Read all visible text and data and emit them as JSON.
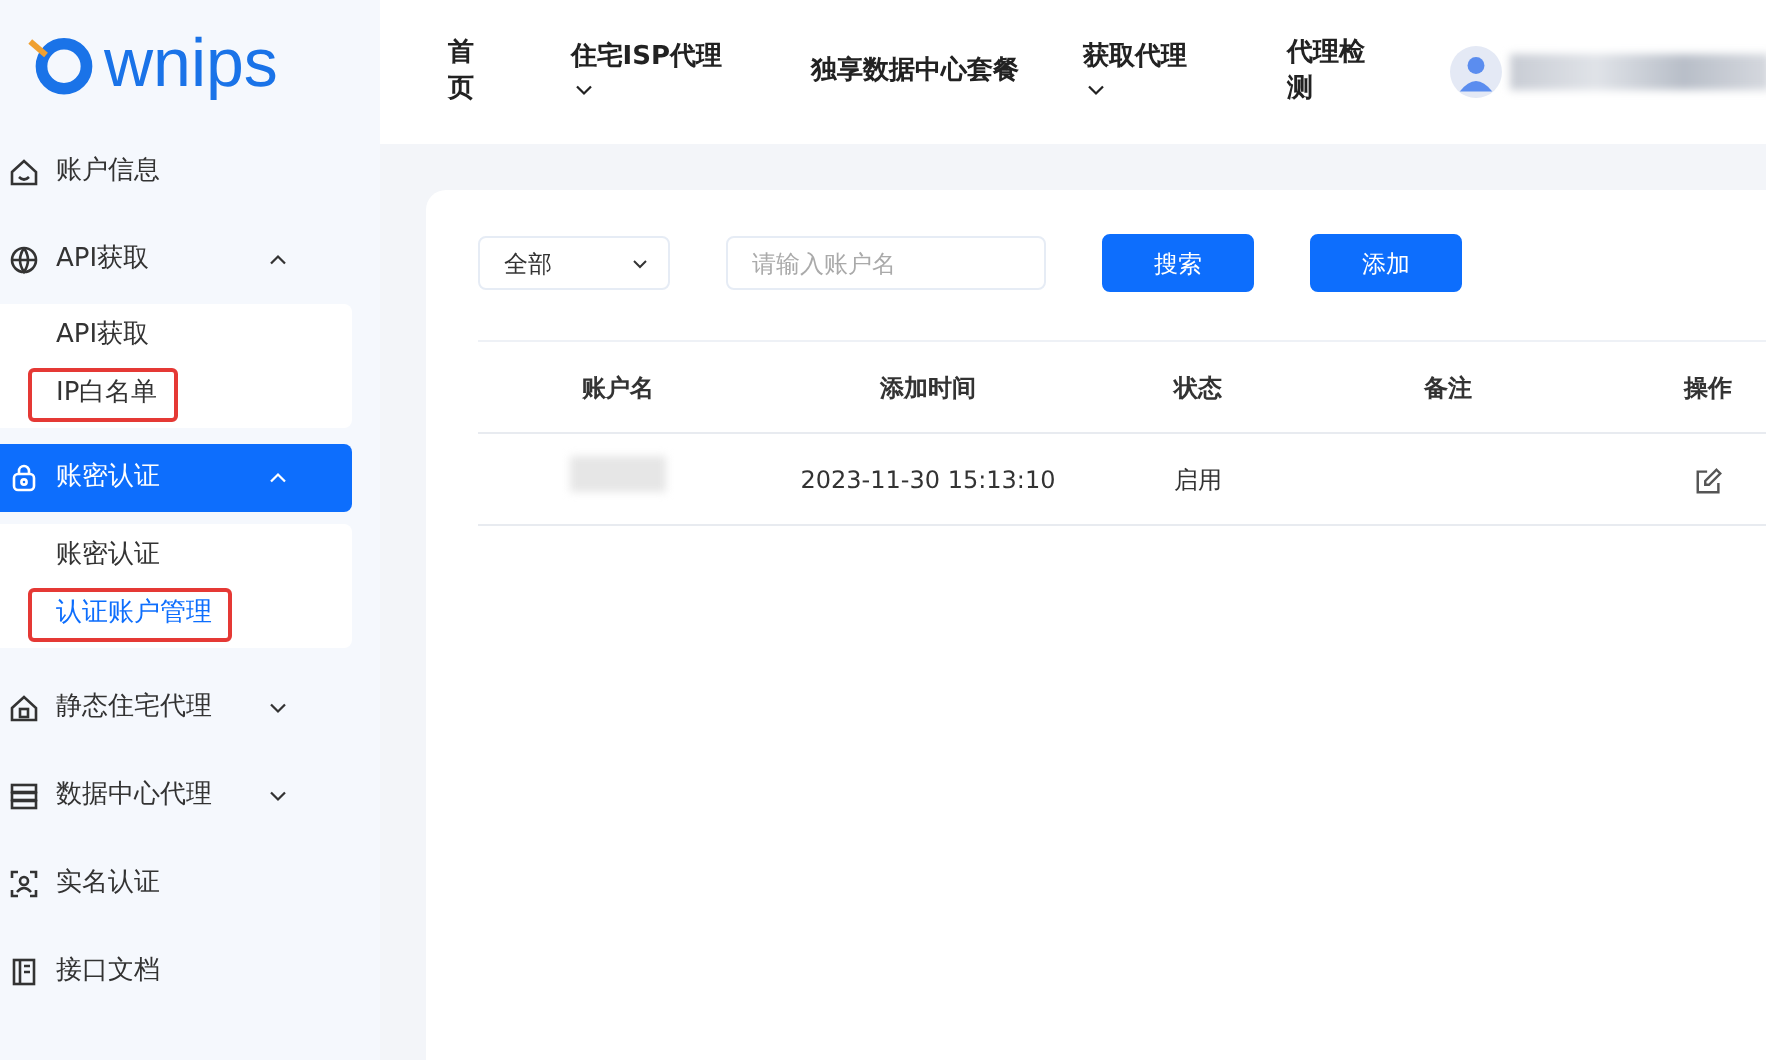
{
  "logo": {
    "text": "wnips"
  },
  "sidebar": [
    {
      "label": "账户信息",
      "kind": "item",
      "selected": false
    },
    {
      "label": "API获取",
      "kind": "group",
      "expanded": true,
      "selected": false,
      "children": [
        {
          "label": "API获取",
          "selected": false,
          "highlighted": false
        },
        {
          "label": "IP白名单",
          "selected": false,
          "highlighted": true
        }
      ]
    },
    {
      "label": "账密认证",
      "kind": "group",
      "expanded": true,
      "selected": true,
      "children": [
        {
          "label": "账密认证",
          "selected": false,
          "highlighted": false
        },
        {
          "label": "认证账户管理",
          "selected": true,
          "highlighted": true
        }
      ]
    },
    {
      "label": "静态住宅代理",
      "kind": "group",
      "expanded": false,
      "selected": false
    },
    {
      "label": "数据中心代理",
      "kind": "group",
      "expanded": false,
      "selected": false
    },
    {
      "label": "实名认证",
      "kind": "item",
      "selected": false
    },
    {
      "label": "接口文档",
      "kind": "item",
      "selected": false
    }
  ],
  "top_nav": [
    {
      "label": "首页",
      "dropdown": false
    },
    {
      "label": "住宅ISP代理",
      "dropdown": true
    },
    {
      "label": "独享数据中心套餐",
      "dropdown": false
    },
    {
      "label": "获取代理",
      "dropdown": true
    },
    {
      "label": "代理检测",
      "dropdown": false
    }
  ],
  "filter": {
    "select_value": "全部",
    "placeholder": "请输入账户名",
    "buttons": [
      "搜索",
      "添加"
    ]
  },
  "table": {
    "columns": [
      "账户名",
      "添加时间",
      "状态",
      "备注",
      "操作"
    ],
    "rows": [
      {
        "account_masked": true,
        "added": "2023-11-30 15:13:10",
        "status": "启用"
      }
    ]
  }
}
